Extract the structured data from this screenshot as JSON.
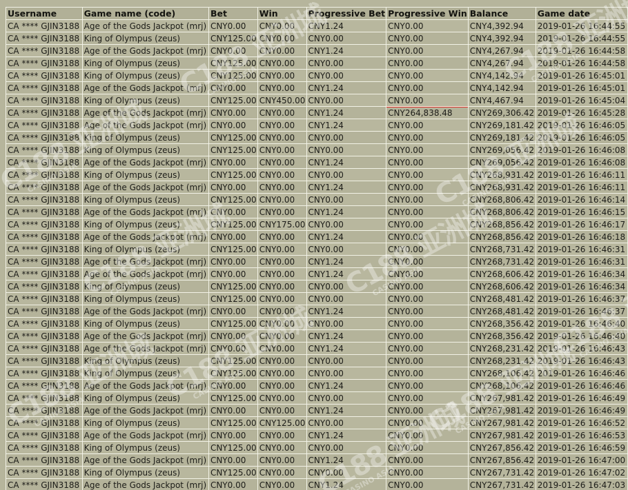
{
  "table": {
    "headers": [
      "Username",
      "Game name (code)",
      "Bet",
      "Win",
      "Progressive Bet",
      "Progressive Win",
      "Balance",
      "Game date"
    ],
    "rows": [
      [
        "CA **** GJIN3188",
        "Age of the Gods Jackpot (mrj)",
        "CNY0.00",
        "CNY0.00",
        "CNY1.24",
        "CNY0.00",
        "CNY4,392.94",
        "2019-01-26 16:44:55"
      ],
      [
        "CA **** GJIN3188",
        "King of Olympus (zeus)",
        "CNY125.00",
        "CNY0.00",
        "CNY0.00",
        "CNY0.00",
        "CNY4,392.94",
        "2019-01-26 16:44:55"
      ],
      [
        "CA **** GJIN3188",
        "Age of the Gods Jackpot (mrj)",
        "CNY0.00",
        "CNY0.00",
        "CNY1.24",
        "CNY0.00",
        "CNY4,267.94",
        "2019-01-26 16:44:58"
      ],
      [
        "CA **** GJIN3188",
        "King of Olympus (zeus)",
        "CNY125.00",
        "CNY0.00",
        "CNY0.00",
        "CNY0.00",
        "CNY4,267.94",
        "2019-01-26 16:44:58"
      ],
      [
        "CA **** GJIN3188",
        "King of Olympus (zeus)",
        "CNY125.00",
        "CNY0.00",
        "CNY0.00",
        "CNY0.00",
        "CNY4,142.94",
        "2019-01-26 16:45:01"
      ],
      [
        "CA **** GJIN3188",
        "Age of the Gods Jackpot (mrj)",
        "CNY0.00",
        "CNY0.00",
        "CNY1.24",
        "CNY0.00",
        "CNY4,142.94",
        "2019-01-26 16:45:01"
      ],
      [
        "CA **** GJIN3188",
        "King of Olympus (zeus)",
        "CNY125.00",
        "CNY450.00",
        "CNY0.00",
        "CNY0.00",
        "CNY4,467.94",
        "2019-01-26 16:45:04"
      ],
      [
        "CA **** GJIN3188",
        "Age of the Gods Jackpot (mrj)",
        "CNY0.00",
        "CNY0.00",
        "CNY1.24",
        "CNY264,838.48",
        "CNY269,306.42",
        "2019-01-26 16:45:28"
      ],
      [
        "CA **** GJIN3188",
        "Age of the Gods Jackpot (mrj)",
        "CNY0.00",
        "CNY0.00",
        "CNY1.24",
        "CNY0.00",
        "CNY269,181.42",
        "2019-01-26 16:46:05"
      ],
      [
        "CA **** GJIN3188",
        "King of Olympus (zeus)",
        "CNY125.00",
        "CNY0.00",
        "CNY0.00",
        "CNY0.00",
        "CNY269,181.42",
        "2019-01-26 16:46:05"
      ],
      [
        "CA **** GJIN3188",
        "King of Olympus (zeus)",
        "CNY125.00",
        "CNY0.00",
        "CNY0.00",
        "CNY0.00",
        "CNY269,056.42",
        "2019-01-26 16:46:08"
      ],
      [
        "CA **** GJIN3188",
        "Age of the Gods Jackpot (mrj)",
        "CNY0.00",
        "CNY0.00",
        "CNY1.24",
        "CNY0.00",
        "CNY269,056.42",
        "2019-01-26 16:46:08"
      ],
      [
        "CA **** GJIN3188",
        "King of Olympus (zeus)",
        "CNY125.00",
        "CNY0.00",
        "CNY0.00",
        "CNY0.00",
        "CNY268,931.42",
        "2019-01-26 16:46:11"
      ],
      [
        "CA **** GJIN3188",
        "Age of the Gods Jackpot (mrj)",
        "CNY0.00",
        "CNY0.00",
        "CNY1.24",
        "CNY0.00",
        "CNY268,931.42",
        "2019-01-26 16:46:11"
      ],
      [
        "CA **** GJIN3188",
        "King of Olympus (zeus)",
        "CNY125.00",
        "CNY0.00",
        "CNY0.00",
        "CNY0.00",
        "CNY268,806.42",
        "2019-01-26 16:46:14"
      ],
      [
        "CA **** GJIN3188",
        "Age of the Gods Jackpot (mrj)",
        "CNY0.00",
        "CNY0.00",
        "CNY1.24",
        "CNY0.00",
        "CNY268,806.42",
        "2019-01-26 16:46:15"
      ],
      [
        "CA **** GJIN3188",
        "King of Olympus (zeus)",
        "CNY125.00",
        "CNY175.00",
        "CNY0.00",
        "CNY0.00",
        "CNY268,856.42",
        "2019-01-26 16:46:17"
      ],
      [
        "CA **** GJIN3188",
        "Age of the Gods Jackpot (mrj)",
        "CNY0.00",
        "CNY0.00",
        "CNY1.24",
        "CNY0.00",
        "CNY268,856.42",
        "2019-01-26 16:46:18"
      ],
      [
        "CA **** GJIN3188",
        "King of Olympus (zeus)",
        "CNY125.00",
        "CNY0.00",
        "CNY0.00",
        "CNY0.00",
        "CNY268,731.42",
        "2019-01-26 16:46:31"
      ],
      [
        "CA **** GJIN3188",
        "Age of the Gods Jackpot (mrj)",
        "CNY0.00",
        "CNY0.00",
        "CNY1.24",
        "CNY0.00",
        "CNY268,731.42",
        "2019-01-26 16:46:31"
      ],
      [
        "CA **** GJIN3188",
        "Age of the Gods Jackpot (mrj)",
        "CNY0.00",
        "CNY0.00",
        "CNY1.24",
        "CNY0.00",
        "CNY268,606.42",
        "2019-01-26 16:46:34"
      ],
      [
        "CA **** GJIN3188",
        "King of Olympus (zeus)",
        "CNY125.00",
        "CNY0.00",
        "CNY0.00",
        "CNY0.00",
        "CNY268,606.42",
        "2019-01-26 16:46:34"
      ],
      [
        "CA **** GJIN3188",
        "King of Olympus (zeus)",
        "CNY125.00",
        "CNY0.00",
        "CNY0.00",
        "CNY0.00",
        "CNY268,481.42",
        "2019-01-26 16:46:37"
      ],
      [
        "CA **** GJIN3188",
        "Age of the Gods Jackpot (mrj)",
        "CNY0.00",
        "CNY0.00",
        "CNY1.24",
        "CNY0.00",
        "CNY268,481.42",
        "2019-01-26 16:46:37"
      ],
      [
        "CA **** GJIN3188",
        "King of Olympus (zeus)",
        "CNY125.00",
        "CNY0.00",
        "CNY0.00",
        "CNY0.00",
        "CNY268,356.42",
        "2019-01-26 16:46:40"
      ],
      [
        "CA **** GJIN3188",
        "Age of the Gods Jackpot (mrj)",
        "CNY0.00",
        "CNY0.00",
        "CNY1.24",
        "CNY0.00",
        "CNY268,356.42",
        "2019-01-26 16:46:40"
      ],
      [
        "CA **** GJIN3188",
        "Age of the Gods Jackpot (mrj)",
        "CNY0.00",
        "CNY0.00",
        "CNY1.24",
        "CNY0.00",
        "CNY268,231.42",
        "2019-01-26 16:46:43"
      ],
      [
        "CA **** GJIN3188",
        "King of Olympus (zeus)",
        "CNY125.00",
        "CNY0.00",
        "CNY0.00",
        "CNY0.00",
        "CNY268,231.42",
        "2019-01-26 16:46:43"
      ],
      [
        "CA **** GJIN3188",
        "King of Olympus (zeus)",
        "CNY125.00",
        "CNY0.00",
        "CNY0.00",
        "CNY0.00",
        "CNY268,106.42",
        "2019-01-26 16:46:46"
      ],
      [
        "CA **** GJIN3188",
        "Age of the Gods Jackpot (mrj)",
        "CNY0.00",
        "CNY0.00",
        "CNY1.24",
        "CNY0.00",
        "CNY268,106.42",
        "2019-01-26 16:46:46"
      ],
      [
        "CA **** GJIN3188",
        "King of Olympus (zeus)",
        "CNY125.00",
        "CNY0.00",
        "CNY0.00",
        "CNY0.00",
        "CNY267,981.42",
        "2019-01-26 16:46:49"
      ],
      [
        "CA **** GJIN3188",
        "Age of the Gods Jackpot (mrj)",
        "CNY0.00",
        "CNY0.00",
        "CNY1.24",
        "CNY0.00",
        "CNY267,981.42",
        "2019-01-26 16:46:49"
      ],
      [
        "CA **** GJIN3188",
        "King of Olympus (zeus)",
        "CNY125.00",
        "CNY125.00",
        "CNY0.00",
        "CNY0.00",
        "CNY267,981.42",
        "2019-01-26 16:46:52"
      ],
      [
        "CA **** GJIN3188",
        "Age of the Gods Jackpot (mrj)",
        "CNY0.00",
        "CNY0.00",
        "CNY1.24",
        "CNY0.00",
        "CNY267,981.42",
        "2019-01-26 16:46:53"
      ],
      [
        "CA **** GJIN3188",
        "King of Olympus (zeus)",
        "CNY125.00",
        "CNY0.00",
        "CNY0.00",
        "CNY0.00",
        "CNY267,856.42",
        "2019-01-26 16:46:59"
      ],
      [
        "CA **** GJIN3188",
        "Age of the Gods Jackpot (mrj)",
        "CNY0.00",
        "CNY0.00",
        "CNY1.24",
        "CNY0.00",
        "CNY267,856.42",
        "2019-01-26 16:47:00"
      ],
      [
        "CA **** GJIN3188",
        "King of Olympus (zeus)",
        "CNY125.00",
        "CNY0.00",
        "CNY0.00",
        "CNY0.00",
        "CNY267,731.42",
        "2019-01-26 16:47:02"
      ],
      [
        "CA **** GJIN3188",
        "Age of the Gods Jackpot (mrj)",
        "CNY0.00",
        "CNY0.00",
        "CNY1.24",
        "CNY0.00",
        "CNY267,731.42",
        "2019-01-26 16:47:03"
      ]
    ],
    "highlight": {
      "row": 7,
      "col": 5,
      "color": "#d8342e"
    }
  },
  "watermark": {
    "logo_text": "C188 亚洲城",
    "sub_text": "CASINO ASIA"
  },
  "colors": {
    "background": "#b6b59c",
    "grid_line": "#f2f2e6",
    "highlight": "#d8342e"
  }
}
